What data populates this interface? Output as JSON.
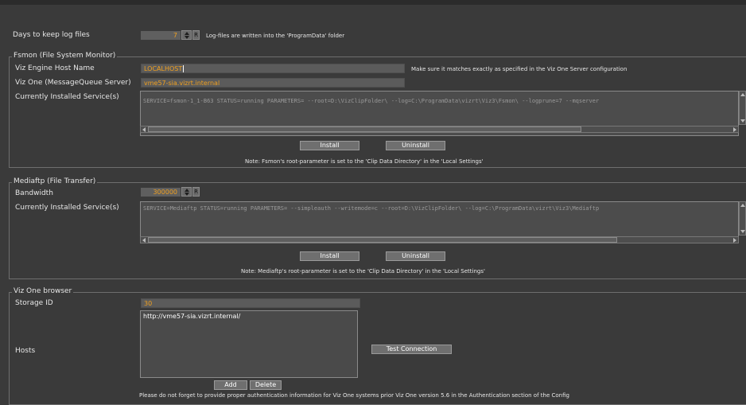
{
  "general": {
    "days_label": "Days to keep log files",
    "days_value": "7",
    "days_note": "Log-files are written into the 'ProgramData' folder",
    "reset_label": "R"
  },
  "fsmon": {
    "legend": "Fsmon (File System Monitor)",
    "viz_engine_label": "Viz Engine Host Name",
    "viz_engine_value": "LOCALHOST",
    "viz_engine_hint": "Make sure it matches exactly as specified in the Viz One Server configuration",
    "vizone_mq_label": "Viz One (MessageQueue Server)",
    "vizone_mq_value": "vme57-sia.vizrt.internal",
    "services_label": "Currently Installed Service(s)",
    "services_text": "SERVICE=fsmon-1_1-B63 STATUS=running PARAMETERS= --root=D:\\VizClipFolder\\ --log=C:\\ProgramData\\vizrt\\Viz3\\Fsmon\\ --logprune=7 --mqserver",
    "install_label": "Install",
    "uninstall_label": "Uninstall",
    "note": "Note: Fsmon's root-parameter is set to the 'Clip Data Directory' in the 'Local Settings'"
  },
  "mediaftp": {
    "legend": "Mediaftp (File Transfer)",
    "bandwidth_label": "Bandwidth",
    "bandwidth_value": "300000",
    "reset_label": "R",
    "services_label": "Currently Installed Service(s)",
    "services_text": "SERVICE=Mediaftp STATUS=running PARAMETERS= --simpleauth --writemode=c --root=D:\\VizClipFolder\\ --log=C:\\ProgramData\\vizrt\\Viz3\\Mediaftp",
    "install_label": "Install",
    "uninstall_label": "Uninstall",
    "note": "Note: Mediaftp's root-parameter is set to the 'Clip Data Directory' in the 'Local Settings'"
  },
  "browser": {
    "legend": "Viz One browser",
    "storage_label": "Storage ID",
    "storage_value": "30",
    "hosts_label": "Hosts",
    "hosts": [
      "http://vme57-sia.vizrt.internal/"
    ],
    "test_connection_label": "Test Connection",
    "add_label": "Add",
    "delete_label": "Delete",
    "auth_note": "Please do not forget to provide proper authentication information for Viz One systems prior Viz One version 5.6 in the Authentication section of the Config"
  },
  "colors": {
    "background": "#3a3a3a",
    "value_text": "#f0a020",
    "field_bg": "#5b5b5b"
  }
}
